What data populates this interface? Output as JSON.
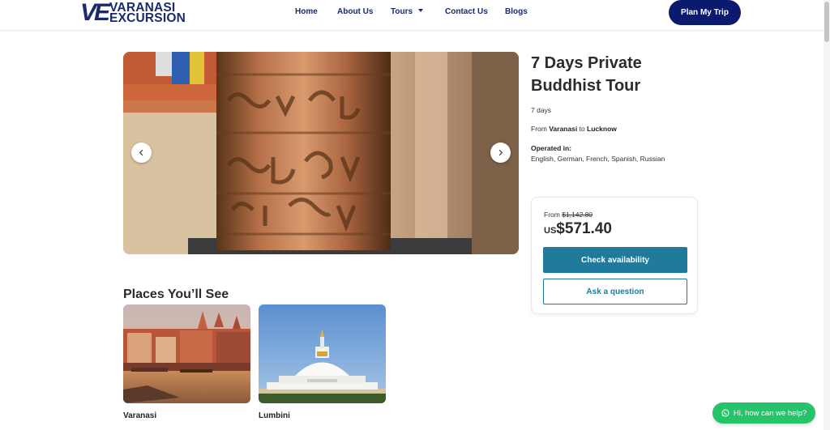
{
  "brand": {
    "mark": "VE",
    "line1": "VARANASI",
    "line2": "EXCURSION",
    "color": "#1a2a6c"
  },
  "nav": {
    "items": [
      "Home",
      "About Us",
      "Tours",
      "Contact Us",
      "Blogs"
    ],
    "plan_label": "Plan My Trip"
  },
  "tour": {
    "title": "7 Days Private Buddhist Tour",
    "duration": "7 days",
    "from_word": "From",
    "from_city": "Varanasi",
    "to_word": "to",
    "to_city": "Lucknow",
    "operated_label": "Operated in:",
    "languages": "English, German, French, Spanish, Russian"
  },
  "pricing": {
    "from_label": "From",
    "original_price": "$1,142.80",
    "currency": "US",
    "price": "$571.40",
    "check_label": "Check availability",
    "ask_label": "Ask a question",
    "accent": "#1f7a9b"
  },
  "gallery": {
    "prev_icon": "chevron-left-icon",
    "next_icon": "chevron-right-icon"
  },
  "places": {
    "title": "Places You’ll See",
    "items": [
      {
        "name": "Varanasi"
      },
      {
        "name": "Lumbini"
      }
    ]
  },
  "whatsapp": {
    "label": "Hi, how can we help?",
    "icon": "whatsapp-icon",
    "color": "#25c46a"
  }
}
